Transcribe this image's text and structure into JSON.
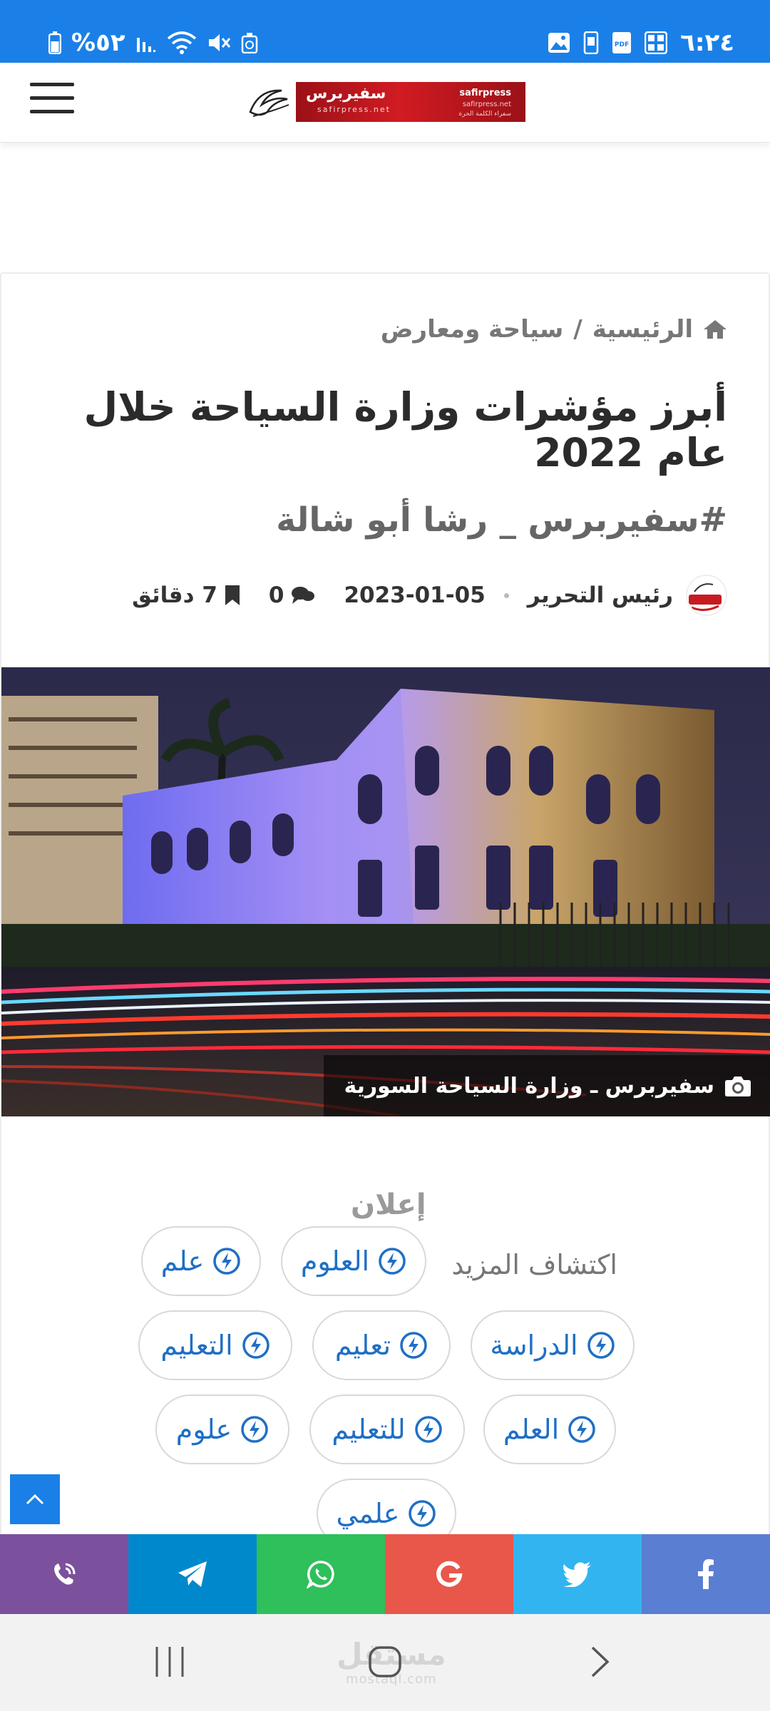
{
  "status_bar": {
    "battery": "%٥٢",
    "time": "٦:٢٤",
    "left_icons": [
      "battery-icon",
      "signal-icon",
      "wifi-icon",
      "mute-icon",
      "recycle-icon"
    ],
    "right_icons": [
      "gallery-icon",
      "phone-icon",
      "pdf-icon",
      "calculator-icon"
    ]
  },
  "header": {
    "logo_arabic": "سفيربرس",
    "logo_english": "safirpress.net",
    "logo_right_en": "safirpress",
    "logo_right_url": "safirpress.net",
    "logo_right_tagline": "سفراء الكلمة الحرة"
  },
  "breadcrumb": {
    "home": "الرئيسية",
    "separator": "/",
    "category": "سياحة ومعارض"
  },
  "article": {
    "title": "أبرز مؤشرات وزارة السياحة خلال عام 2022",
    "subtitle": "#سفيربرس _ رشا أبو شالة",
    "author": "رئيس التحرير",
    "date": "2023-01-05",
    "comments": "0",
    "read_time": "7 دقائق",
    "image_caption": "سفيربرس ـ وزارة السياحة السورية"
  },
  "ads": {
    "label": "إعلان",
    "discover": "اكتشاف المزيد",
    "chips": [
      "العلوم",
      "علم",
      "الدراسة",
      "تعليم",
      "التعليم",
      "العلم",
      "للتعليم",
      "علوم",
      "علمي"
    ]
  },
  "share_bar": {
    "buttons": [
      {
        "name": "viber",
        "color": "#7b519d"
      },
      {
        "name": "telegram",
        "color": "#0088cc"
      },
      {
        "name": "whatsapp",
        "color": "#2fbf5b"
      },
      {
        "name": "google",
        "color": "#e8574a"
      },
      {
        "name": "twitter",
        "color": "#32b4f0"
      },
      {
        "name": "facebook",
        "color": "#5a7ed1"
      }
    ]
  },
  "nav": {
    "watermark": "مستقل",
    "watermark_en": "mostaql.com"
  },
  "colors": {
    "status_bar": "#1a80e8",
    "accent": "#1f6fc5"
  }
}
